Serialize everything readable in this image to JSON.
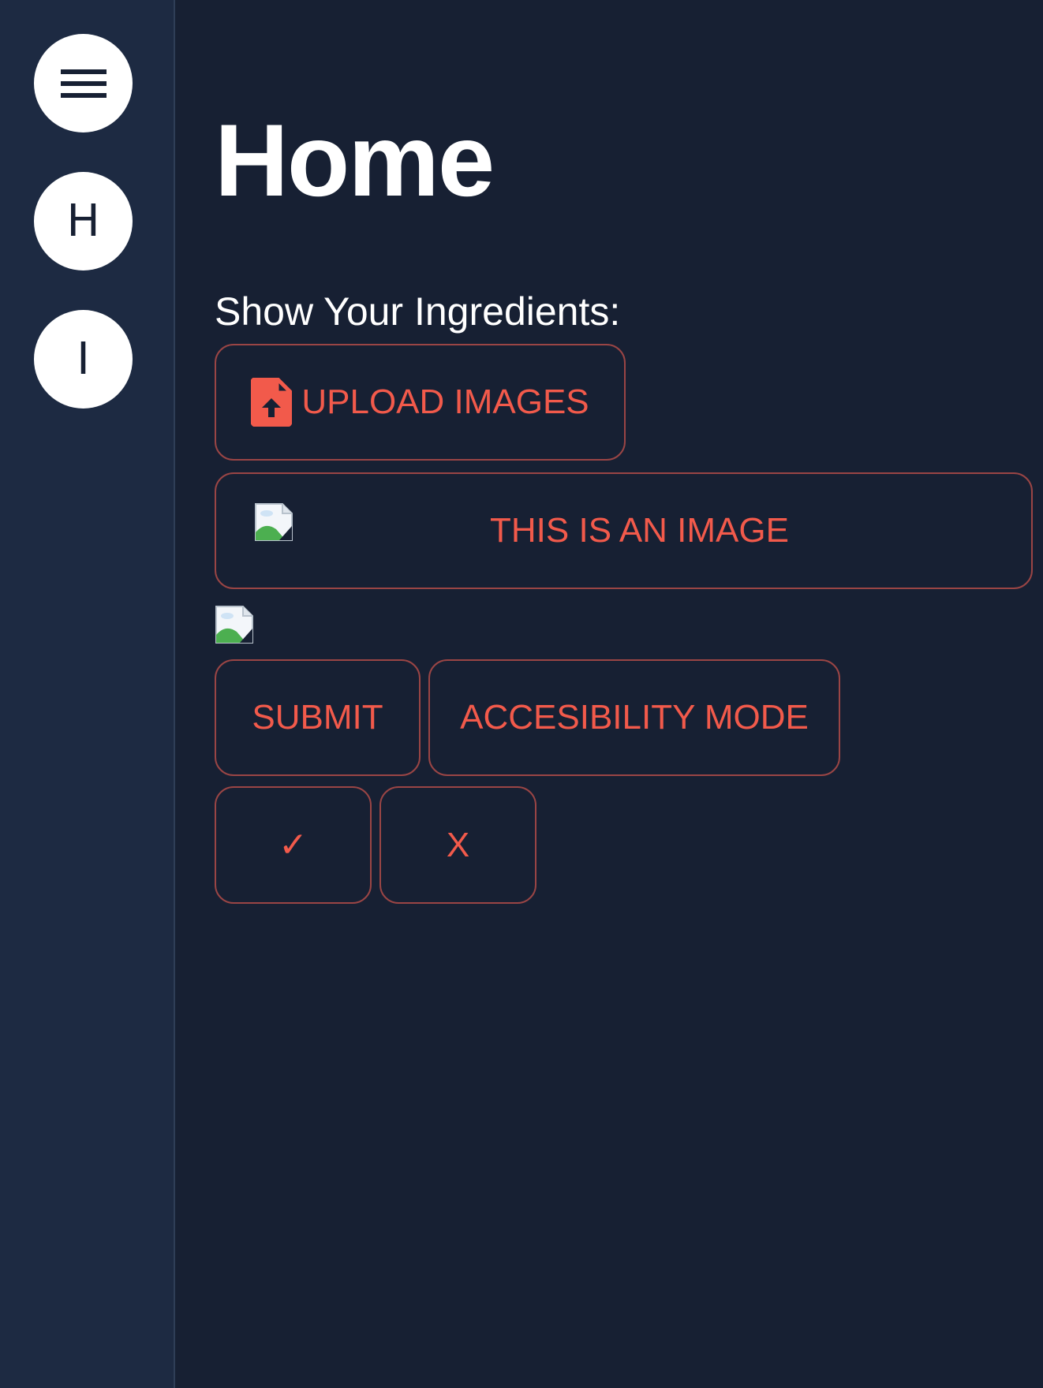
{
  "sidebar": {
    "items": [
      {
        "icon": "hamburger-menu-icon",
        "label": ""
      },
      {
        "label": "H"
      },
      {
        "label": "I"
      }
    ]
  },
  "main": {
    "title": "Home",
    "ingredients_label": "Show Your Ingredients:",
    "upload_button": {
      "label": "UPLOAD IMAGES",
      "icon": "file-upload-icon"
    },
    "image_button": {
      "label": "THIS IS AN IMAGE",
      "icon": "broken-image-icon"
    },
    "submit_label": "SUBMIT",
    "accessibility_label": "ACCESIBILITY MODE",
    "confirm_label": "✓",
    "reject_label": "X"
  },
  "colors": {
    "background": "#172033",
    "sidebar": "#1d2a42",
    "accent": "#f25a4b",
    "button_border": "#9a4545",
    "text": "#ffffff"
  }
}
